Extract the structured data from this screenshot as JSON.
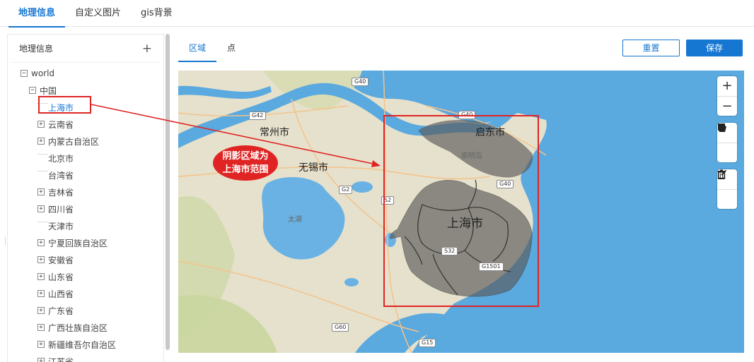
{
  "top_tabs": [
    {
      "label": "地理信息",
      "active": true
    },
    {
      "label": "自定义图片",
      "active": false
    },
    {
      "label": "gis背景",
      "active": false
    }
  ],
  "left": {
    "title": "地理信息",
    "add": "+",
    "tree": [
      {
        "label": "world",
        "level": 0,
        "toggle": "−",
        "selected": false
      },
      {
        "label": "中国",
        "level": 1,
        "toggle": "−",
        "selected": false
      },
      {
        "label": "上海市",
        "level": 2,
        "toggle": "",
        "selected": true
      },
      {
        "label": "云南省",
        "level": 2,
        "toggle": "+",
        "selected": false
      },
      {
        "label": "内蒙古自治区",
        "level": 2,
        "toggle": "+",
        "selected": false
      },
      {
        "label": "北京市",
        "level": 2,
        "toggle": "",
        "selected": false
      },
      {
        "label": "台湾省",
        "level": 2,
        "toggle": "",
        "selected": false
      },
      {
        "label": "吉林省",
        "level": 2,
        "toggle": "+",
        "selected": false
      },
      {
        "label": "四川省",
        "level": 2,
        "toggle": "+",
        "selected": false
      },
      {
        "label": "天津市",
        "level": 2,
        "toggle": "",
        "selected": false
      },
      {
        "label": "宁夏回族自治区",
        "level": 2,
        "toggle": "+",
        "selected": false
      },
      {
        "label": "安徽省",
        "level": 2,
        "toggle": "+",
        "selected": false
      },
      {
        "label": "山东省",
        "level": 2,
        "toggle": "+",
        "selected": false
      },
      {
        "label": "山西省",
        "level": 2,
        "toggle": "+",
        "selected": false
      },
      {
        "label": "广东省",
        "level": 2,
        "toggle": "+",
        "selected": false
      },
      {
        "label": "广西壮族自治区",
        "level": 2,
        "toggle": "+",
        "selected": false
      },
      {
        "label": "新疆维吾尔自治区",
        "level": 2,
        "toggle": "+",
        "selected": false
      },
      {
        "label": "江苏省",
        "level": 2,
        "toggle": "+",
        "selected": false
      }
    ]
  },
  "main": {
    "tabs": [
      {
        "label": "区域",
        "active": true
      },
      {
        "label": "点",
        "active": false
      }
    ],
    "reset_label": "重置",
    "save_label": "保存"
  },
  "map": {
    "labels": {
      "changzhou": "常州市",
      "wuxi": "无锡市",
      "qidong": "启东市",
      "chongming": "崇明岛",
      "shanghai": "上海市",
      "taihu": "太湖"
    },
    "roads": {
      "g40a": "G40",
      "g40b": "G40",
      "g40c": "G40",
      "g42": "G42",
      "g2": "G2",
      "s2": "S2",
      "s32": "S32",
      "g1501": "G1501",
      "g60": "G60",
      "g15": "G15"
    },
    "zoom_in": "+",
    "zoom_out": "−",
    "callout_line1": "阴影区域为",
    "callout_line2": "上海市范围"
  },
  "colors": {
    "accent": "#1677d2",
    "annotation": "#e02424",
    "water": "#5aa9df",
    "land": "#e8e2cf",
    "shade": "#6b6b6b"
  }
}
